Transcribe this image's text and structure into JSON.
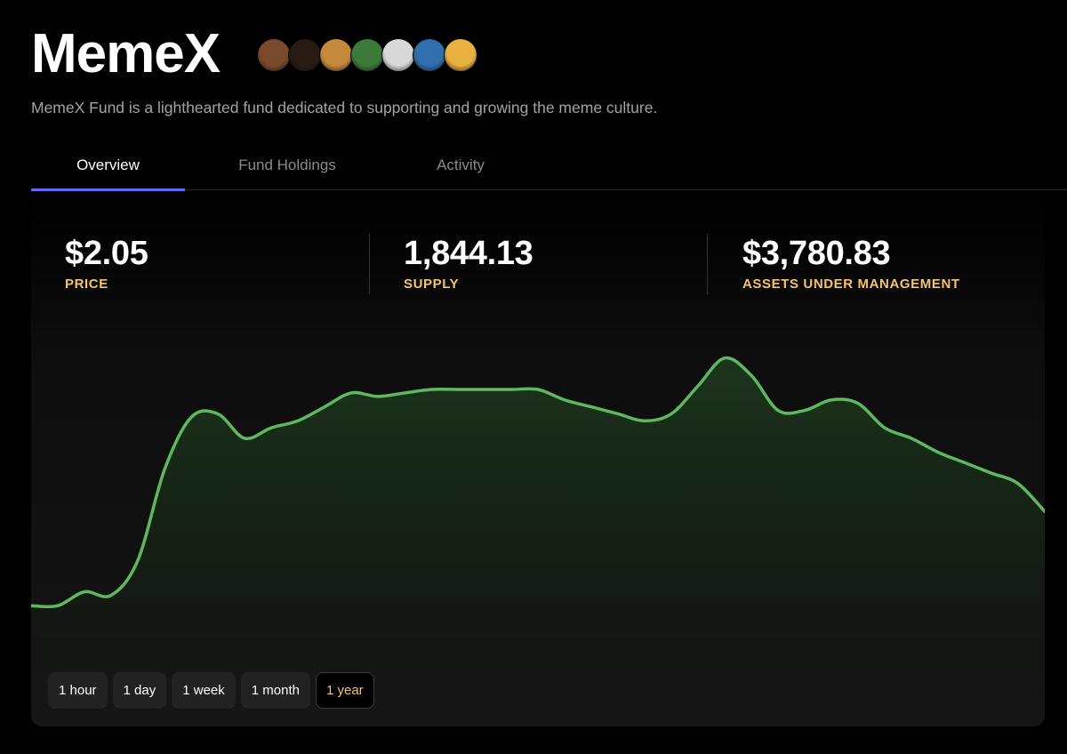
{
  "header": {
    "title": "MemeX",
    "description": "MemeX Fund is a lighthearted fund dedicated to supporting and growing the meme culture.",
    "avatars": [
      {
        "name": "bear-avatar",
        "color": "#7a4a2c"
      },
      {
        "name": "dark-mask-avatar",
        "color": "#2a1a14"
      },
      {
        "name": "duck-avatar",
        "color": "#c48a3a"
      },
      {
        "name": "green-frog-avatar",
        "color": "#3c7a3a"
      },
      {
        "name": "dartboard-avatar",
        "color": "#d8d8d8"
      },
      {
        "name": "wolf-avatar",
        "color": "#2f6fb0"
      },
      {
        "name": "cowboy-avatar",
        "color": "#e8b040"
      }
    ]
  },
  "tabs": [
    {
      "label": "Overview",
      "active": true
    },
    {
      "label": "Fund Holdings",
      "active": false
    },
    {
      "label": "Activity",
      "active": false
    }
  ],
  "stats": [
    {
      "value": "$2.05",
      "label": "PRICE"
    },
    {
      "value": "1,844.13",
      "label": "SUPPLY"
    },
    {
      "value": "$3,780.83",
      "label": "ASSETS UNDER MANAGEMENT"
    }
  ],
  "range_buttons": [
    {
      "label": "1 hour",
      "active": false
    },
    {
      "label": "1 day",
      "active": false
    },
    {
      "label": "1 week",
      "active": false
    },
    {
      "label": "1 month",
      "active": false
    },
    {
      "label": "1 year",
      "active": true
    }
  ],
  "colors": {
    "line": "#5fb85f",
    "accent": "#f4c46b",
    "tab_underline": "#5b6cf5"
  },
  "chart_data": {
    "type": "area",
    "title": "",
    "xlabel": "",
    "ylabel": "",
    "grid": false,
    "x": [
      0,
      1,
      2,
      3,
      4,
      5,
      6,
      7,
      8,
      9,
      10,
      11,
      12,
      13,
      14,
      15,
      16,
      17,
      18,
      19,
      20,
      21,
      22,
      23,
      24,
      25,
      26,
      27,
      28,
      29,
      30,
      31,
      32,
      33,
      34,
      35,
      36,
      37,
      38
    ],
    "values": [
      0.29,
      0.29,
      0.33,
      0.32,
      0.42,
      0.68,
      0.83,
      0.84,
      0.77,
      0.8,
      0.82,
      0.86,
      0.9,
      0.89,
      0.9,
      0.91,
      0.91,
      0.91,
      0.91,
      0.91,
      0.88,
      0.86,
      0.84,
      0.82,
      0.84,
      0.92,
      1.0,
      0.95,
      0.85,
      0.85,
      0.88,
      0.87,
      0.8,
      0.77,
      0.73,
      0.7,
      0.67,
      0.64,
      0.56
    ],
    "ylim": [
      0,
      1.3
    ]
  }
}
